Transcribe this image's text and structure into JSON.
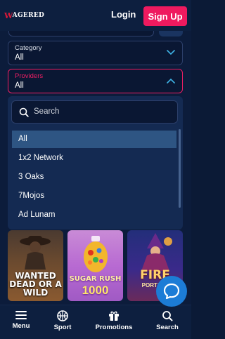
{
  "header": {
    "logo_text": "WAGERED",
    "login_label": "Login",
    "signup_label": "Sign Up"
  },
  "filters": {
    "category": {
      "label": "Category",
      "value": "All"
    },
    "providers": {
      "label": "Providers",
      "value": "All"
    }
  },
  "dropdown": {
    "search_placeholder": "Search",
    "options": [
      {
        "label": "All",
        "selected": true
      },
      {
        "label": "1x2 Network",
        "selected": false
      },
      {
        "label": "3 Oaks",
        "selected": false
      },
      {
        "label": "7Mojos",
        "selected": false
      },
      {
        "label": "Ad Lunam",
        "selected": false
      }
    ]
  },
  "games": [
    {
      "title": "WANTED DEAD OR A WILD"
    },
    {
      "title": "SUGAR RUSH",
      "number": "1000"
    },
    {
      "title": "FIRE",
      "subtitle": "PORTALS"
    }
  ],
  "nav": {
    "items": [
      {
        "label": "Menu",
        "icon": "menu-icon"
      },
      {
        "label": "Sport",
        "icon": "basketball-icon"
      },
      {
        "label": "Promotions",
        "icon": "gift-icon"
      },
      {
        "label": "Search",
        "icon": "search-icon"
      }
    ]
  },
  "colors": {
    "accent": "#ef1a5f",
    "background": "#0c1c3b",
    "selected_option": "#2e5583",
    "chat": "#1c7cd6"
  }
}
